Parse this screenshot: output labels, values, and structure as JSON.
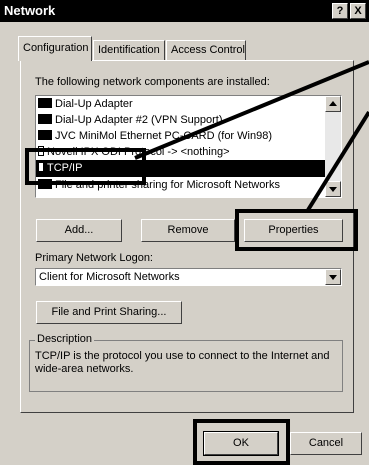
{
  "title": "Network",
  "title_buttons": {
    "help": "?",
    "close": "X"
  },
  "tabs": [
    {
      "label": "Configuration"
    },
    {
      "label": "Identification"
    },
    {
      "label": "Access Control"
    }
  ],
  "components_label": "The following network components are installed:",
  "components": [
    {
      "label": "Dial-Up Adapter"
    },
    {
      "label": "Dial-Up Adapter #2 (VPN Support)"
    },
    {
      "label": "JVC MiniMol Ethernet PC-CARD (for Win98)"
    },
    {
      "label": "Novell IPX ODI Protocol -> <nothing>"
    },
    {
      "label": "TCP/IP",
      "selected": true
    },
    {
      "label": "File and printer sharing for Microsoft Networks"
    }
  ],
  "buttons": {
    "add": "Add...",
    "remove": "Remove",
    "properties": "Properties",
    "file_print": "File and Print Sharing...",
    "ok": "OK",
    "cancel": "Cancel"
  },
  "logon_label": "Primary Network Logon:",
  "logon_value": "Client for Microsoft Networks",
  "description_title": "Description",
  "description_text": "TCP/IP is the protocol you use to connect to the Internet and wide-area networks."
}
